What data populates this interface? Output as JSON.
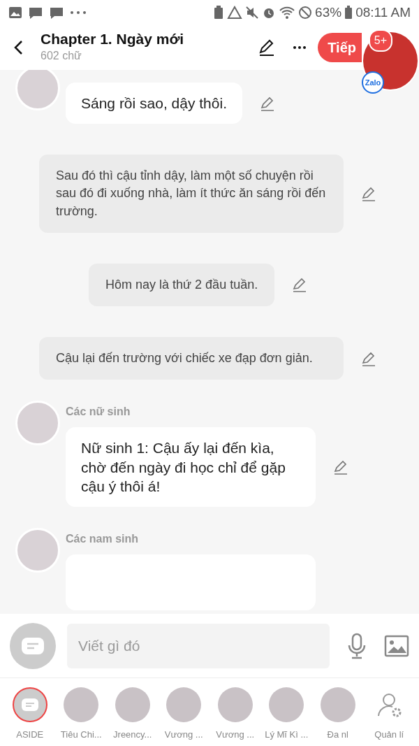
{
  "status_bar": {
    "battery": "63%",
    "time": "08:11 AM"
  },
  "header": {
    "title": "Chapter 1. Ngày mới",
    "subtitle": "602 chữ",
    "next_button": "Tiếp"
  },
  "floating_bubble": {
    "badge": "5+",
    "label": "Zalo"
  },
  "messages": [
    {
      "kind": "character",
      "text": "Sáng rồi sao, dậy thôi."
    },
    {
      "kind": "narration",
      "text": "Sau đó thì cậu tỉnh dậy, làm một số chuyện rồi sau đó đi xuống nhà, làm ít thức ăn sáng rồi đến trường."
    },
    {
      "kind": "center",
      "text": "Hôm nay là thứ 2 đầu tuần."
    },
    {
      "kind": "narration",
      "text": "Cậu lại đến trường với chiếc xe đạp đơn giản."
    },
    {
      "kind": "character",
      "name": "Các nữ sinh",
      "text": "Nữ sinh 1: Cậu ấy lại đến kìa, chờ đến ngày đi học chỉ để gặp cậu ý thôi á!"
    },
    {
      "kind": "character",
      "name": "Các nam sinh"
    }
  ],
  "composer": {
    "placeholder": "Viết gì đó"
  },
  "characters": [
    {
      "kind": "aside",
      "label": "ASIDE",
      "selected": true
    },
    {
      "kind": "avatar",
      "label": "Tiêu Chi...",
      "selected": false
    },
    {
      "kind": "avatar",
      "label": "Jreency...",
      "selected": false
    },
    {
      "kind": "avatar",
      "label": "Vương ...",
      "selected": false
    },
    {
      "kind": "avatar",
      "label": "Vương ...",
      "selected": false
    },
    {
      "kind": "avatar",
      "label": "Lý Mĩ Kì ...",
      "selected": false
    },
    {
      "kind": "avatar",
      "label": "Đa nl",
      "selected": false
    },
    {
      "kind": "manage",
      "label": "Quản lí",
      "selected": false
    }
  ]
}
